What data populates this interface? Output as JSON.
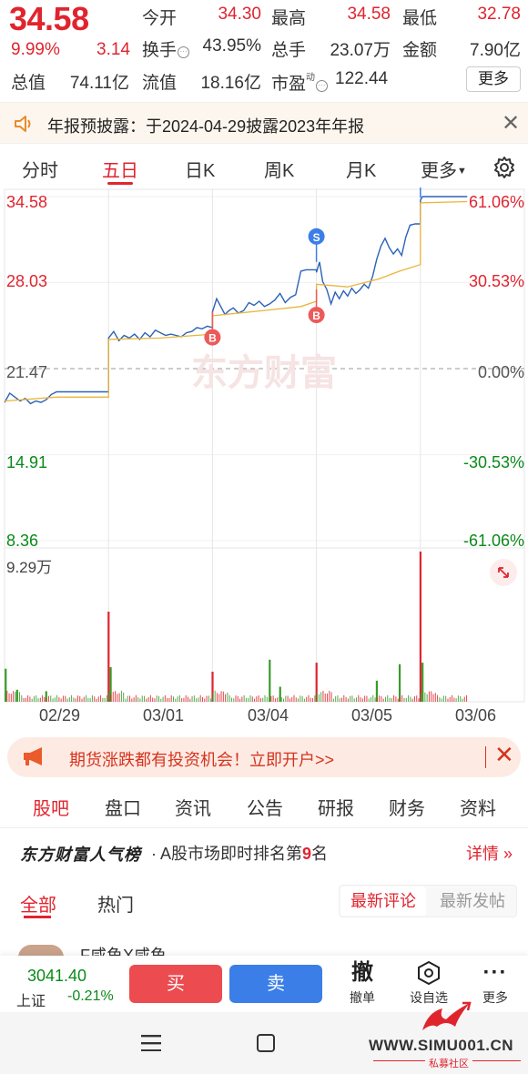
{
  "quote": {
    "price": "34.58",
    "change_pct": "9.99%",
    "change_abs": "3.14",
    "fields": {
      "open_label": "今开",
      "open_value": "34.30",
      "high_label": "最高",
      "high_value": "34.58",
      "low_label": "最低",
      "low_value": "32.78",
      "turnover_label": "换手",
      "turnover_value": "43.95%",
      "volume_label": "总手",
      "volume_value": "23.07万",
      "amount_label": "金额",
      "amount_value": "7.90亿",
      "mktcap_label": "总值",
      "mktcap_value": "74.11亿",
      "float_label": "流值",
      "float_value": "18.16亿",
      "pe_label": "市盈",
      "pe_superscript": "动",
      "pe_value": "122.44"
    },
    "more_button": "更多"
  },
  "notice": {
    "text": "年报预披露：于2024-04-29披露2023年年报",
    "close_icon": "close-icon"
  },
  "period_tabs": {
    "items": [
      "分时",
      "五日",
      "日K",
      "周K",
      "月K",
      "更多"
    ],
    "active": "五日"
  },
  "chart": {
    "y_left": [
      "34.58",
      "28.03",
      "21.47",
      "14.91",
      "8.36"
    ],
    "y_right": [
      "61.06%",
      "30.53%",
      "0.00%",
      "-30.53%",
      "-61.06%"
    ],
    "volume_max": "9.29万",
    "dates": [
      "02/29",
      "03/01",
      "03/04",
      "03/05",
      "03/06"
    ],
    "watermark": "东方财富",
    "markers": [
      {
        "type": "B",
        "day": 2
      },
      {
        "type": "B",
        "day": 3
      },
      {
        "type": "S",
        "day": 3
      },
      {
        "type": "S",
        "day": 4
      }
    ]
  },
  "chart_data": {
    "type": "line",
    "title": "",
    "xlabel": "",
    "ylabel": "",
    "ylim": [
      8.36,
      34.58
    ],
    "reference_price": 21.47,
    "categories": [
      "02/29",
      "03/01",
      "03/04",
      "03/05",
      "03/06"
    ],
    "series": [
      {
        "name": "",
        "color": "#2a62b8",
        "values": [
          [
            0.0,
            18.9
          ],
          [
            0.05,
            19.6
          ],
          [
            0.1,
            19.3
          ],
          [
            0.15,
            19.0
          ],
          [
            0.2,
            19.2
          ],
          [
            0.25,
            18.8
          ],
          [
            0.3,
            19.0
          ],
          [
            0.35,
            18.9
          ],
          [
            0.4,
            19.1
          ],
          [
            0.45,
            19.5
          ],
          [
            0.5,
            19.7
          ],
          [
            0.6,
            19.7
          ],
          [
            0.7,
            19.7
          ],
          [
            0.8,
            19.7
          ],
          [
            0.9,
            19.7
          ],
          [
            1.0,
            19.7
          ],
          [
            1.0,
            23.8
          ],
          [
            1.05,
            24.3
          ],
          [
            1.1,
            23.6
          ],
          [
            1.15,
            24.0
          ],
          [
            1.2,
            23.8
          ],
          [
            1.25,
            24.1
          ],
          [
            1.3,
            23.7
          ],
          [
            1.35,
            24.2
          ],
          [
            1.4,
            23.9
          ],
          [
            1.45,
            24.4
          ],
          [
            1.5,
            24.2
          ],
          [
            1.55,
            24.0
          ],
          [
            1.6,
            24.1
          ],
          [
            1.65,
            24.0
          ],
          [
            1.7,
            23.9
          ],
          [
            1.75,
            24.2
          ],
          [
            1.8,
            24.3
          ],
          [
            1.85,
            24.6
          ],
          [
            1.9,
            24.5
          ],
          [
            1.95,
            24.7
          ],
          [
            2.0,
            24.6
          ],
          [
            2.0,
            25.8
          ],
          [
            2.04,
            26.8
          ],
          [
            2.08,
            26.2
          ],
          [
            2.12,
            25.6
          ],
          [
            2.16,
            25.9
          ],
          [
            2.2,
            26.1
          ],
          [
            2.25,
            25.7
          ],
          [
            2.3,
            25.9
          ],
          [
            2.35,
            26.5
          ],
          [
            2.4,
            26.3
          ],
          [
            2.45,
            26.6
          ],
          [
            2.5,
            26.2
          ],
          [
            2.55,
            26.4
          ],
          [
            2.6,
            26.7
          ],
          [
            2.65,
            27.2
          ],
          [
            2.7,
            26.5
          ],
          [
            2.75,
            26.9
          ],
          [
            2.8,
            27.1
          ],
          [
            2.85,
            28.9
          ],
          [
            2.9,
            29.0
          ],
          [
            2.95,
            29.0
          ],
          [
            3.0,
            29.0
          ],
          [
            3.0,
            28.8
          ],
          [
            3.03,
            29.6
          ],
          [
            3.06,
            28.1
          ],
          [
            3.1,
            27.5
          ],
          [
            3.14,
            26.4
          ],
          [
            3.18,
            27.3
          ],
          [
            3.22,
            26.8
          ],
          [
            3.26,
            27.4
          ],
          [
            3.3,
            27.0
          ],
          [
            3.34,
            27.6
          ],
          [
            3.38,
            27.2
          ],
          [
            3.42,
            27.5
          ],
          [
            3.46,
            27.9
          ],
          [
            3.5,
            27.6
          ],
          [
            3.54,
            28.5
          ],
          [
            3.58,
            29.8
          ],
          [
            3.62,
            30.8
          ],
          [
            3.66,
            31.4
          ],
          [
            3.7,
            30.7
          ],
          [
            3.74,
            30.2
          ],
          [
            3.78,
            30.6
          ],
          [
            3.82,
            30.1
          ],
          [
            3.86,
            31.5
          ],
          [
            3.9,
            32.4
          ],
          [
            3.95,
            32.5
          ],
          [
            4.0,
            32.5
          ],
          [
            4.0,
            34.3
          ],
          [
            4.02,
            34.58
          ],
          [
            4.05,
            34.58
          ],
          [
            4.1,
            34.58
          ],
          [
            4.2,
            34.58
          ],
          [
            4.3,
            34.58
          ],
          [
            4.4,
            34.58
          ],
          [
            4.45,
            34.58
          ]
        ]
      },
      {
        "name": "",
        "color": "#e8b53a",
        "values": [
          [
            0.0,
            19.0
          ],
          [
            0.5,
            19.3
          ],
          [
            1.0,
            19.3
          ],
          [
            1.0,
            23.7
          ],
          [
            1.5,
            23.8
          ],
          [
            2.0,
            24.1
          ],
          [
            2.0,
            25.5
          ],
          [
            2.5,
            25.9
          ],
          [
            2.85,
            26.2
          ],
          [
            3.0,
            26.6
          ],
          [
            3.0,
            27.9
          ],
          [
            3.3,
            27.7
          ],
          [
            3.6,
            28.3
          ],
          [
            3.8,
            28.9
          ],
          [
            4.0,
            29.4
          ],
          [
            4.0,
            34.1
          ],
          [
            4.45,
            34.2
          ]
        ]
      }
    ],
    "volume": {
      "max": "9.29万",
      "spikes": [
        {
          "x": 0.01,
          "v": 0.22
        },
        {
          "x": 0.12,
          "v": 0.08
        },
        {
          "x": 0.4,
          "v": 0.07
        },
        {
          "x": 1.0,
          "v": 0.6
        },
        {
          "x": 1.02,
          "v": 0.23
        },
        {
          "x": 2.0,
          "v": 0.2
        },
        {
          "x": 2.55,
          "v": 0.28
        },
        {
          "x": 2.65,
          "v": 0.1
        },
        {
          "x": 3.0,
          "v": 0.26
        },
        {
          "x": 3.58,
          "v": 0.14
        },
        {
          "x": 3.8,
          "v": 0.25
        },
        {
          "x": 4.0,
          "v": 1.0
        },
        {
          "x": 4.02,
          "v": 0.26
        }
      ]
    }
  },
  "ad": {
    "text": "期货涨跌都有投资机会！立即开户>>",
    "close": "✕"
  },
  "info_tabs": {
    "items": [
      "股吧",
      "盘口",
      "资讯",
      "公告",
      "研报",
      "财务",
      "资料"
    ],
    "active": "股吧"
  },
  "popularity": {
    "brand": "东方财富人气榜",
    "prefix": "· A股市场即时排名第",
    "rank": "9",
    "suffix": "名",
    "detail": "详情"
  },
  "comment_tabs": {
    "items": [
      "全部",
      "热门"
    ],
    "active": "全部",
    "sort_latest": "最新评论",
    "sort_newpost": "最新发帖"
  },
  "post_peek": {
    "author": "F咸鱼X咸鱼"
  },
  "trade_bar": {
    "index_value": "3041.40",
    "index_name": "上证",
    "index_change": "-0.21%",
    "buy": "买",
    "sell": "卖",
    "cancel_label": "撤单",
    "cancel_icon_text": "撤",
    "watch_label": "设自选",
    "more_label": "更多"
  },
  "watermark": {
    "url": "WWW.SIMU001.CN",
    "sub": "私募社区"
  },
  "colors": {
    "up": "#e0242e",
    "down": "#0a8a1a",
    "price_line": "#2a62b8",
    "avg_line": "#e8b53a",
    "buy": "#ec4b4f",
    "sell": "#3b7ee8"
  }
}
